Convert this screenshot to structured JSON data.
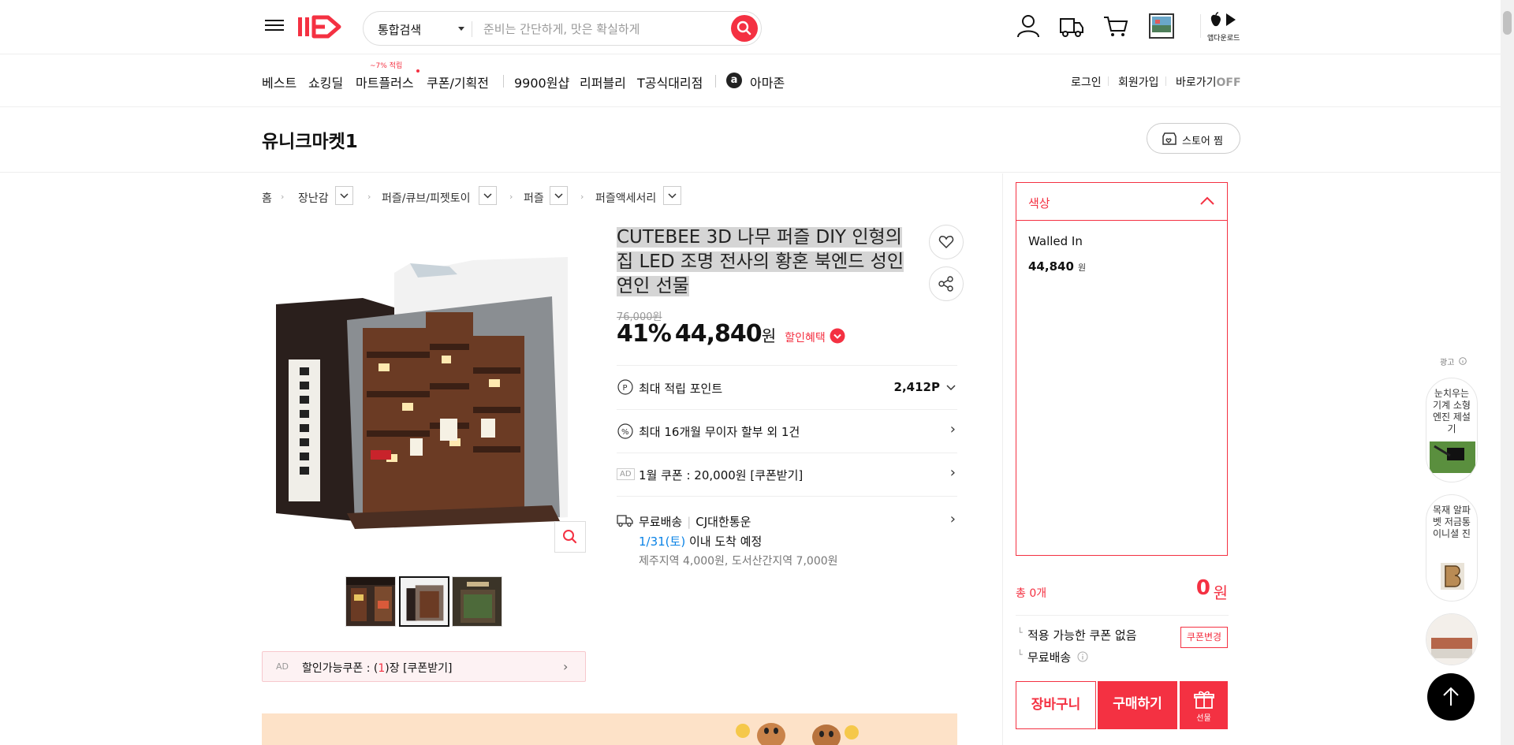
{
  "header": {
    "search_category": "통합검색",
    "search_placeholder": "준비는 간단하게, 맛은 확실하게",
    "app_download": "앱다운로드"
  },
  "gnb": {
    "items": [
      "베스트",
      "쇼킹딜",
      "마트플러스",
      "쿠폰/기획전",
      "9900원샵",
      "리퍼블리",
      "T공식대리점",
      "아마존"
    ],
    "mart_badge": "~7% 적립",
    "util": [
      "로그인",
      "회원가입"
    ],
    "shortcut_label": "바로가기",
    "shortcut_state": "OFF"
  },
  "store": {
    "name": "유니크마켓1",
    "follow_label": "스토어 찜"
  },
  "breadcrumb": [
    "홈",
    "장난감",
    "퍼즐/큐브/피젯토이",
    "퍼즐",
    "퍼즐액세서리"
  ],
  "product": {
    "title": "CUTEBEE 3D 나무 퍼즐 DIY 인형의 집 LED 조명 전사의 황혼 북엔드 성인 연인 선물",
    "original_price": "76,000원",
    "discount": "41%",
    "price": "44,840",
    "price_unit": "원",
    "benefit_label": "할인혜택",
    "points_label": "최대 적립 포인트",
    "points_value": "2,412P",
    "installment": "최대 16개월 무이자 할부 외 1건",
    "ad_badge": "AD",
    "coupon_row": "1월 쿠폰 : 20,000원 [쿠폰받기]",
    "shipping_label": "무료배송",
    "carrier": "CJ대한통운",
    "arrival_date": "1/31(토)",
    "arrival_text": "이내 도착 예정",
    "extra_fee": "제주지역 4,000원, 도서산간지역 7,000원",
    "coupon_bar_ad": "AD",
    "coupon_bar_prefix": "할인가능쿠폰 : (",
    "coupon_bar_count": "1",
    "coupon_bar_suffix": ")장 [쿠폰받기]"
  },
  "option": {
    "header": "색상",
    "item_name": "Walled In",
    "item_price": "44,840",
    "item_unit": "원"
  },
  "summary": {
    "total_label": "총 0개",
    "total_value": "0",
    "total_unit": "원",
    "coupon_none": "적용 가능한 쿠폰 없음",
    "coupon_change": "쿠폰변경",
    "free_shipping": "무료배송",
    "cart_button": "장바구니",
    "buy_button": "구매하기",
    "gift_button": "선물"
  },
  "side_ads": {
    "label": "광고",
    "items": [
      "눈치우는기계 소형 엔진 제설기",
      "목재 알파벳 저금통 이니셜 진"
    ]
  },
  "colors": {
    "accent": "#f43142",
    "link_blue": "#0b83e6"
  }
}
